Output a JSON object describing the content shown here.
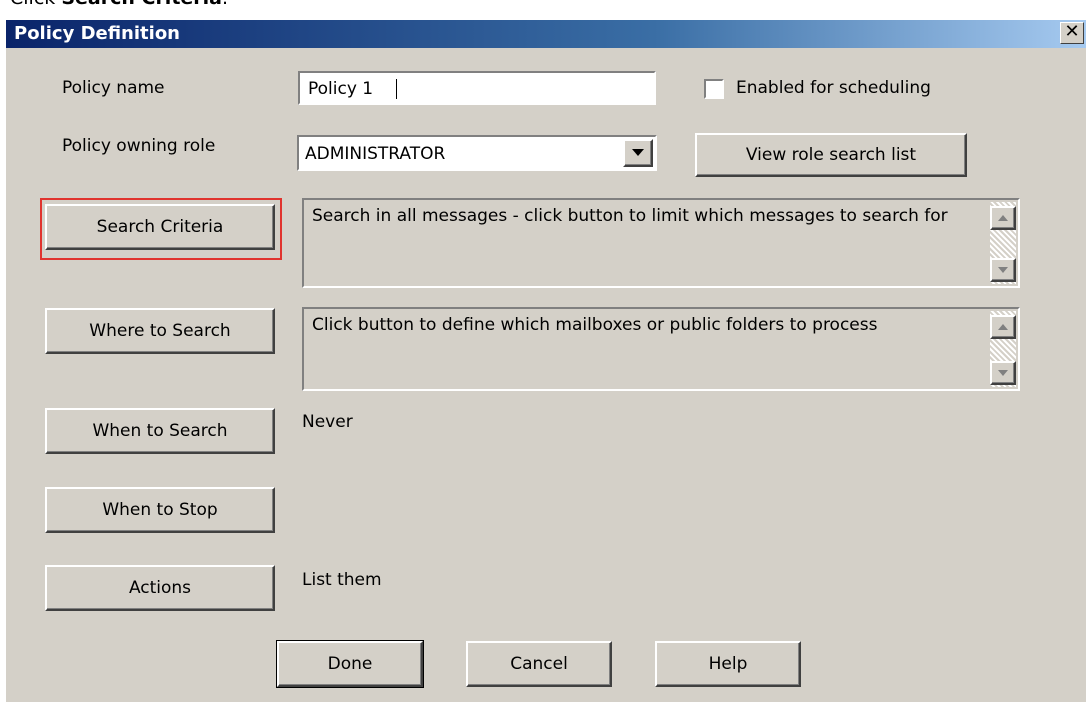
{
  "caption": {
    "prefix": "Click ",
    "bold": "Search Criteria",
    "suffix": "."
  },
  "dialog": {
    "title": "Policy Definition",
    "close_symbol": "✕"
  },
  "fields": {
    "policy_name_label": "Policy name",
    "policy_name_value": "Policy 1",
    "enabled_label": "Enabled for scheduling",
    "enabled_checked": false,
    "owning_role_label": "Policy owning role",
    "owning_role_value": "ADMINISTRATOR"
  },
  "buttons": {
    "view_role": "View role search list",
    "search_criteria": "Search Criteria",
    "where_to_search": "Where to Search",
    "when_to_search": "When to Search",
    "when_to_stop": "When to Stop",
    "actions": "Actions",
    "done": "Done",
    "cancel": "Cancel",
    "help": "Help"
  },
  "descriptions": {
    "search_criteria": "Search in all messages - click button to limit which messages to search for",
    "where_to_search": "Click button to define which mailboxes or public folders to process",
    "when_to_search": "Never",
    "actions": "List them"
  },
  "colors": {
    "highlight": "#e0332e",
    "dialog_bg": "#d4d0c8",
    "titlebar": "#0a246a"
  }
}
